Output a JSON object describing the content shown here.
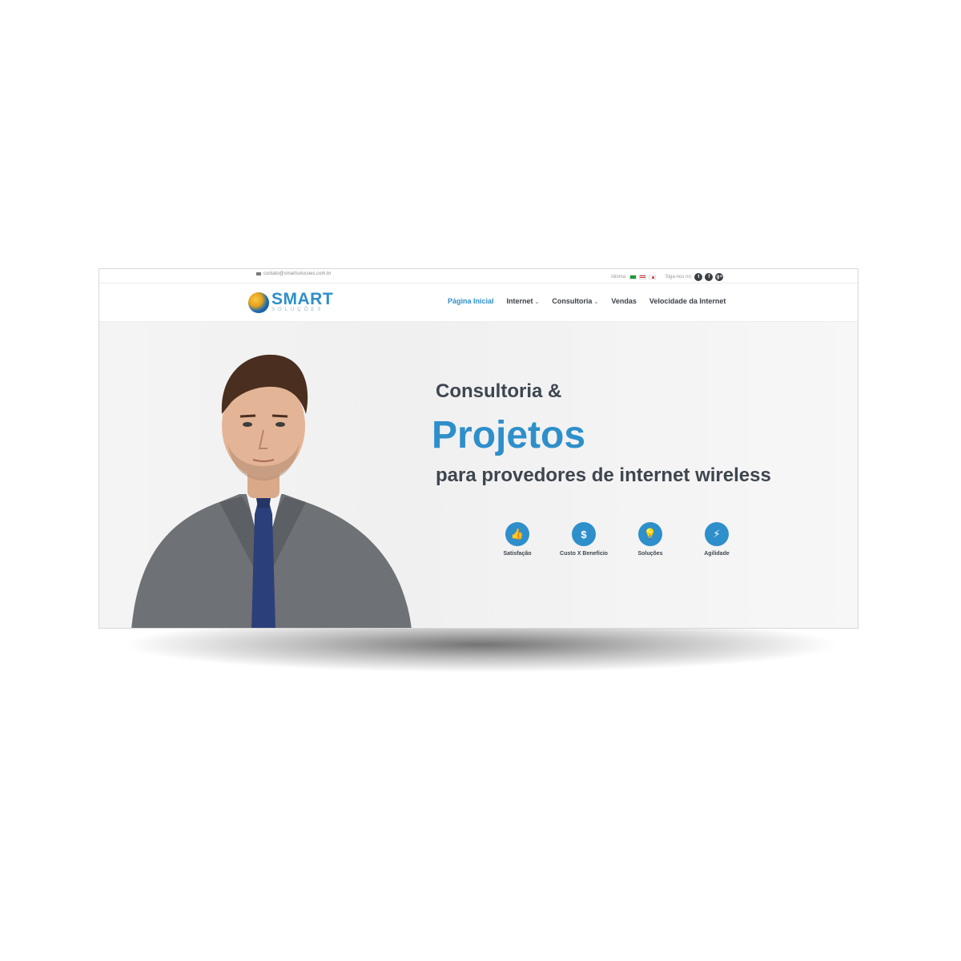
{
  "topbar": {
    "email": "contato@smartsolucoes.com.br",
    "idioma_label": "Idioma:",
    "follow_label": "Siga-nos no:",
    "social": [
      "t",
      "f",
      "g+"
    ]
  },
  "logo": {
    "name": "SMART",
    "sub": "SOLUÇÕES"
  },
  "nav": {
    "items": [
      {
        "label": "Página Inicial",
        "dropdown": false,
        "active": true
      },
      {
        "label": "Internet",
        "dropdown": true
      },
      {
        "label": "Consultoria",
        "dropdown": true
      },
      {
        "label": "Vendas",
        "dropdown": false
      },
      {
        "label": "Velocidade da Internet",
        "dropdown": false
      }
    ]
  },
  "hero": {
    "line1": "Consultoria &",
    "line2": "Projetos",
    "line3": "para provedores de internet wireless"
  },
  "features": [
    {
      "label": "Satisfação",
      "icon": "thumbs-up-icon",
      "glyph": "👍"
    },
    {
      "label": "Custo X Benefício",
      "icon": "dollar-icon",
      "glyph": "$"
    },
    {
      "label": "Soluções",
      "icon": "lightbulb-icon",
      "glyph": "💡"
    },
    {
      "label": "Agilidade",
      "icon": "lightning-icon",
      "glyph": "⚡"
    }
  ],
  "colors": {
    "accent": "#2e8fca",
    "text_dark": "#3e464f"
  }
}
